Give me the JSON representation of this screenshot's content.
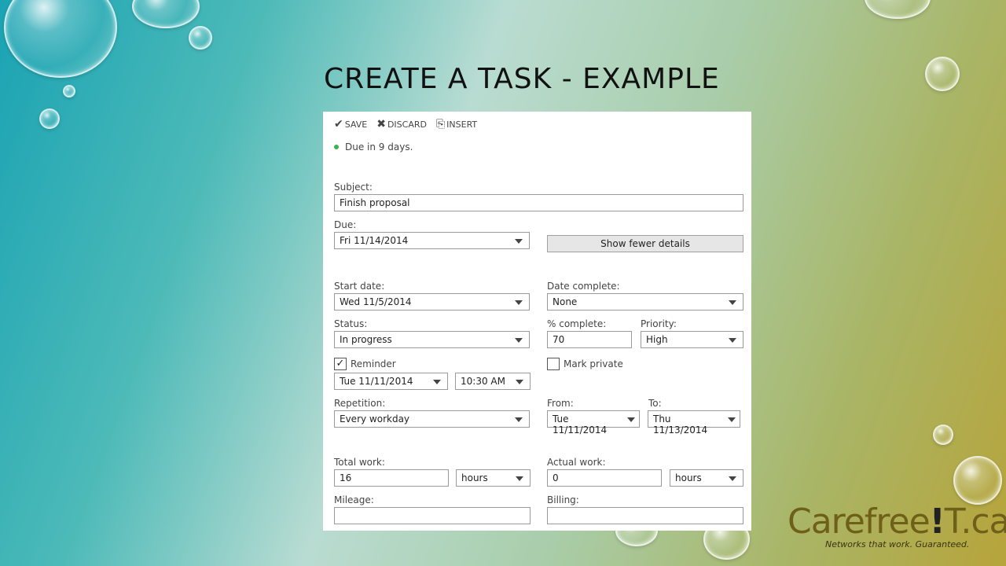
{
  "slide": {
    "title": "CREATE A TASK - EXAMPLE"
  },
  "toolbar": {
    "save_label": "SAVE",
    "discard_label": "DISCARD",
    "insert_label": "INSERT"
  },
  "status_note": "Due in 9 days.",
  "form": {
    "subject_label": "Subject:",
    "subject_value": "Finish proposal",
    "due_label": "Due:",
    "due_value": "Fri 11/14/2014",
    "show_fewer_label": "Show fewer details",
    "start_date_label": "Start date:",
    "start_date_value": "Wed 11/5/2014",
    "date_complete_label": "Date complete:",
    "date_complete_value": "None",
    "status_label": "Status:",
    "status_value": "In progress",
    "percent_complete_label": "% complete:",
    "percent_complete_value": "70",
    "priority_label": "Priority:",
    "priority_value": "High",
    "reminder_label": "Reminder",
    "reminder_checked": true,
    "mark_private_label": "Mark private",
    "mark_private_checked": false,
    "reminder_date_value": "Tue 11/11/2014",
    "reminder_time_value": "10:30 AM",
    "repetition_label": "Repetition:",
    "repetition_value": "Every workday",
    "from_label": "From:",
    "from_value": "Tue 11/11/2014",
    "to_label": "To:",
    "to_value": "Thu 11/13/2014",
    "total_work_label": "Total work:",
    "total_work_value": "16",
    "total_work_unit": "hours",
    "actual_work_label": "Actual work:",
    "actual_work_value": "0",
    "actual_work_unit": "hours",
    "mileage_label": "Mileage:",
    "mileage_value": "",
    "billing_label": "Billing:",
    "billing_value": ""
  },
  "logo": {
    "name_part1": "Carefree",
    "name_excl": "!",
    "name_part2": "T.ca",
    "tagline": "Networks that work. Guaranteed."
  },
  "icons": {
    "save": "checkmark-icon",
    "discard": "x-icon",
    "insert": "paperclip-icon",
    "status": "green-dot-icon"
  },
  "colors": {
    "status_dot": "#3bb44a",
    "panel_bg": "#ffffff"
  }
}
